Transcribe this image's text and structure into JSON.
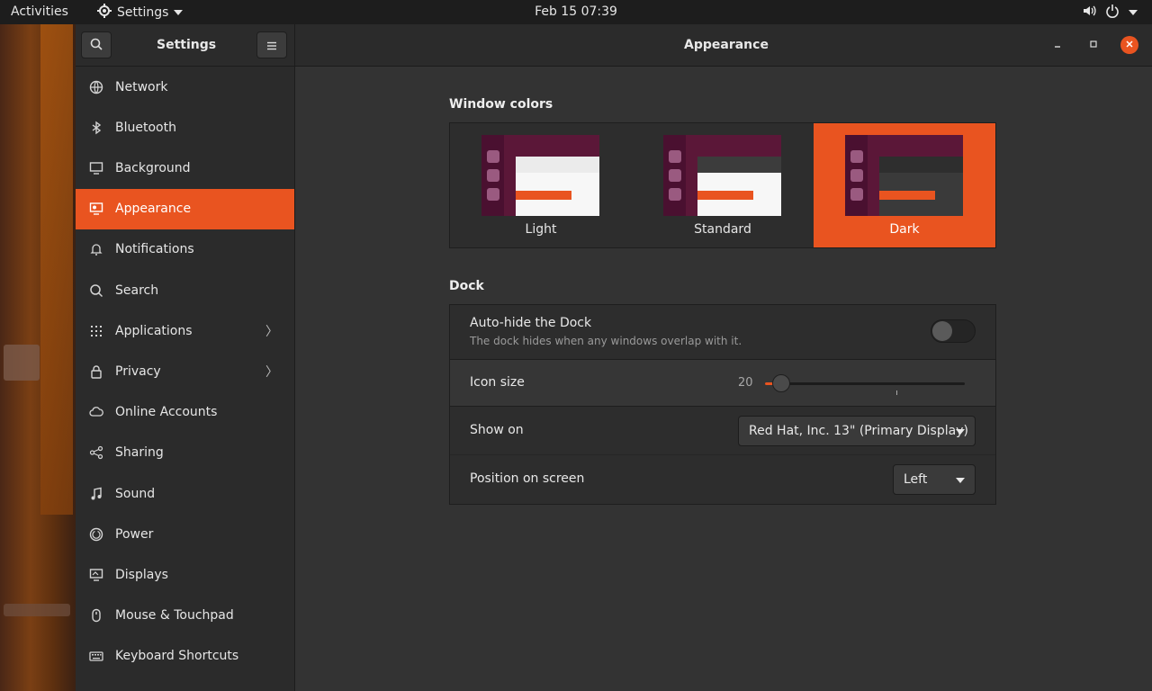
{
  "topbar": {
    "activities": "Activities",
    "app_name": "Settings",
    "clock": "Feb 15  07:39"
  },
  "window": {
    "sidebar_title": "Settings",
    "page_title": "Appearance"
  },
  "sidebar": {
    "items": [
      {
        "label": "Network",
        "icon": "network-icon"
      },
      {
        "label": "Bluetooth",
        "icon": "bluetooth-icon"
      },
      {
        "label": "Background",
        "icon": "background-icon"
      },
      {
        "label": "Appearance",
        "icon": "appearance-icon",
        "active": true
      },
      {
        "label": "Notifications",
        "icon": "bell-icon"
      },
      {
        "label": "Search",
        "icon": "search-icon"
      },
      {
        "label": "Applications",
        "icon": "grid-icon",
        "chevron": true
      },
      {
        "label": "Privacy",
        "icon": "lock-icon",
        "chevron": true
      },
      {
        "label": "Online Accounts",
        "icon": "cloud-icon"
      },
      {
        "label": "Sharing",
        "icon": "share-icon"
      },
      {
        "label": "Sound",
        "icon": "music-note-icon"
      },
      {
        "label": "Power",
        "icon": "power-icon"
      },
      {
        "label": "Displays",
        "icon": "display-icon"
      },
      {
        "label": "Mouse & Touchpad",
        "icon": "mouse-icon"
      },
      {
        "label": "Keyboard Shortcuts",
        "icon": "keyboard-icon"
      }
    ]
  },
  "appearance": {
    "window_colors_title": "Window colors",
    "themes": [
      {
        "label": "Light",
        "selected": false
      },
      {
        "label": "Standard",
        "selected": false
      },
      {
        "label": "Dark",
        "selected": true
      }
    ],
    "dock_title": "Dock",
    "autohide": {
      "label": "Auto-hide the Dock",
      "description": "The dock hides when any windows overlap with it.",
      "enabled": false
    },
    "icon_size": {
      "label": "Icon size",
      "value": "20",
      "level": 0.08
    },
    "show_on": {
      "label": "Show on",
      "value": "Red Hat, Inc. 13\" (Primary Display)"
    },
    "position": {
      "label": "Position on screen",
      "value": "Left"
    }
  },
  "colors": {
    "accent": "#e95420"
  }
}
